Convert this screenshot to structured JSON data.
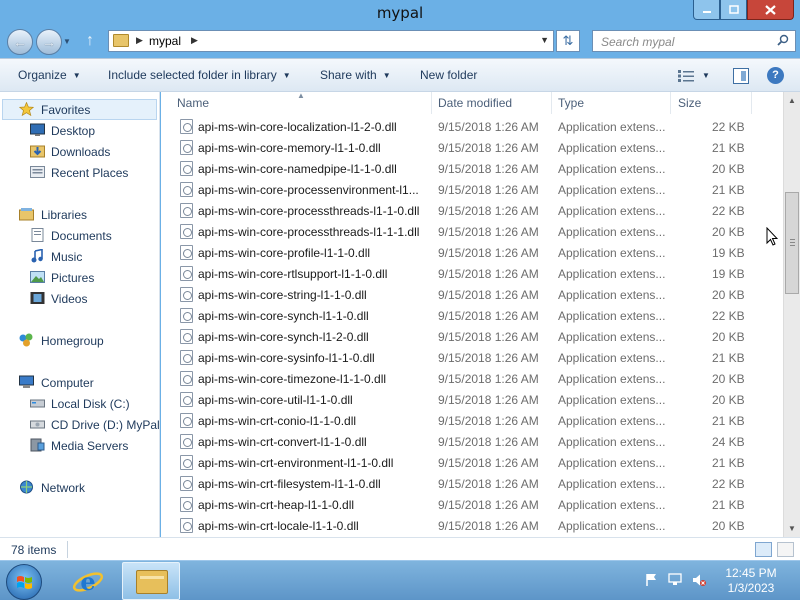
{
  "window": {
    "title": "mypal"
  },
  "address": {
    "path_segment": "mypal",
    "search_placeholder": "Search mypal"
  },
  "toolbar": {
    "organize": "Organize",
    "include_library": "Include selected folder in library",
    "share_with": "Share with",
    "new_folder": "New folder"
  },
  "nav": {
    "favorites": "Favorites",
    "desktop": "Desktop",
    "downloads": "Downloads",
    "recent_places": "Recent Places",
    "libraries": "Libraries",
    "documents": "Documents",
    "music": "Music",
    "pictures": "Pictures",
    "videos": "Videos",
    "homegroup": "Homegroup",
    "computer": "Computer",
    "local_disk": "Local Disk (C:)",
    "cd_drive": "CD Drive (D:) MyPal",
    "media_servers": "Media Servers",
    "network": "Network"
  },
  "columns": {
    "name": "Name",
    "date": "Date modified",
    "type": "Type",
    "size": "Size"
  },
  "files": [
    {
      "name": "api-ms-win-core-localization-l1-2-0.dll",
      "date": "9/15/2018 1:26 AM",
      "type": "Application extens...",
      "size": "22 KB"
    },
    {
      "name": "api-ms-win-core-memory-l1-1-0.dll",
      "date": "9/15/2018 1:26 AM",
      "type": "Application extens...",
      "size": "21 KB"
    },
    {
      "name": "api-ms-win-core-namedpipe-l1-1-0.dll",
      "date": "9/15/2018 1:26 AM",
      "type": "Application extens...",
      "size": "20 KB"
    },
    {
      "name": "api-ms-win-core-processenvironment-l1...",
      "date": "9/15/2018 1:26 AM",
      "type": "Application extens...",
      "size": "21 KB"
    },
    {
      "name": "api-ms-win-core-processthreads-l1-1-0.dll",
      "date": "9/15/2018 1:26 AM",
      "type": "Application extens...",
      "size": "22 KB"
    },
    {
      "name": "api-ms-win-core-processthreads-l1-1-1.dll",
      "date": "9/15/2018 1:26 AM",
      "type": "Application extens...",
      "size": "20 KB"
    },
    {
      "name": "api-ms-win-core-profile-l1-1-0.dll",
      "date": "9/15/2018 1:26 AM",
      "type": "Application extens...",
      "size": "19 KB"
    },
    {
      "name": "api-ms-win-core-rtlsupport-l1-1-0.dll",
      "date": "9/15/2018 1:26 AM",
      "type": "Application extens...",
      "size": "19 KB"
    },
    {
      "name": "api-ms-win-core-string-l1-1-0.dll",
      "date": "9/15/2018 1:26 AM",
      "type": "Application extens...",
      "size": "20 KB"
    },
    {
      "name": "api-ms-win-core-synch-l1-1-0.dll",
      "date": "9/15/2018 1:26 AM",
      "type": "Application extens...",
      "size": "22 KB"
    },
    {
      "name": "api-ms-win-core-synch-l1-2-0.dll",
      "date": "9/15/2018 1:26 AM",
      "type": "Application extens...",
      "size": "20 KB"
    },
    {
      "name": "api-ms-win-core-sysinfo-l1-1-0.dll",
      "date": "9/15/2018 1:26 AM",
      "type": "Application extens...",
      "size": "21 KB"
    },
    {
      "name": "api-ms-win-core-timezone-l1-1-0.dll",
      "date": "9/15/2018 1:26 AM",
      "type": "Application extens...",
      "size": "20 KB"
    },
    {
      "name": "api-ms-win-core-util-l1-1-0.dll",
      "date": "9/15/2018 1:26 AM",
      "type": "Application extens...",
      "size": "20 KB"
    },
    {
      "name": "api-ms-win-crt-conio-l1-1-0.dll",
      "date": "9/15/2018 1:26 AM",
      "type": "Application extens...",
      "size": "21 KB"
    },
    {
      "name": "api-ms-win-crt-convert-l1-1-0.dll",
      "date": "9/15/2018 1:26 AM",
      "type": "Application extens...",
      "size": "24 KB"
    },
    {
      "name": "api-ms-win-crt-environment-l1-1-0.dll",
      "date": "9/15/2018 1:26 AM",
      "type": "Application extens...",
      "size": "21 KB"
    },
    {
      "name": "api-ms-win-crt-filesystem-l1-1-0.dll",
      "date": "9/15/2018 1:26 AM",
      "type": "Application extens...",
      "size": "22 KB"
    },
    {
      "name": "api-ms-win-crt-heap-l1-1-0.dll",
      "date": "9/15/2018 1:26 AM",
      "type": "Application extens...",
      "size": "21 KB"
    },
    {
      "name": "api-ms-win-crt-locale-l1-1-0.dll",
      "date": "9/15/2018 1:26 AM",
      "type": "Application extens...",
      "size": "20 KB"
    }
  ],
  "status": {
    "item_count": "78 items"
  },
  "taskbar": {
    "time": "12:45 PM",
    "date": "1/3/2023"
  }
}
